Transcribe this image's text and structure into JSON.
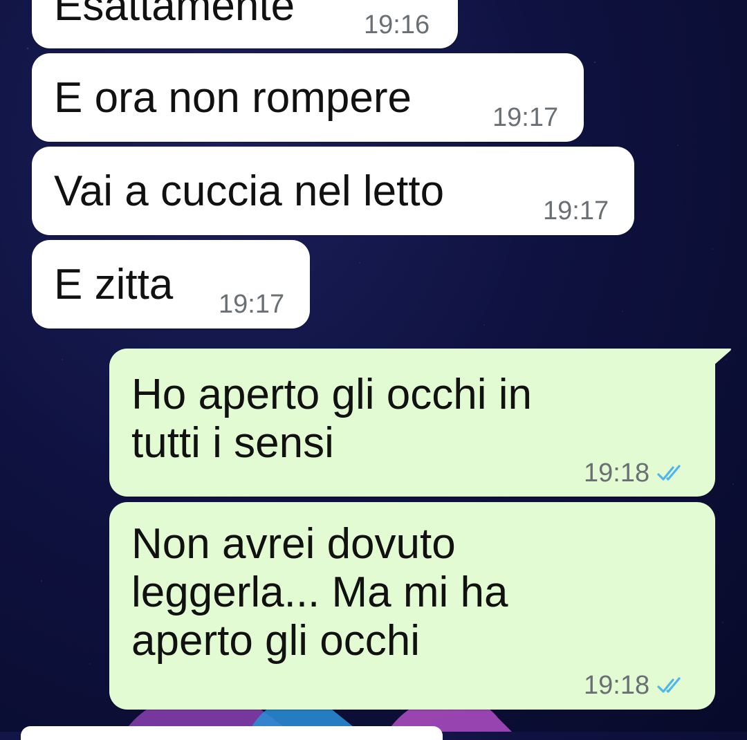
{
  "colors": {
    "incoming_bubble": "#ffffff",
    "outgoing_bubble": "#e3fbd2",
    "read_ticks": "#4fb6ec",
    "timestamp": "#6a6f74"
  },
  "messages": [
    {
      "direction": "incoming",
      "text": "Esattamente",
      "time": "19:16"
    },
    {
      "direction": "incoming",
      "text": "E ora non rompere",
      "time": "19:17"
    },
    {
      "direction": "incoming",
      "text": "Vai a cuccia nel letto",
      "time": "19:17"
    },
    {
      "direction": "incoming",
      "text": "E zitta",
      "time": "19:17"
    },
    {
      "direction": "outgoing",
      "text": "Ho aperto gli occhi in\ntutti i sensi",
      "time": "19:18",
      "status_icon": "double-check-read-icon"
    },
    {
      "direction": "outgoing",
      "text": "Non avrei dovuto\nleggerla... Ma mi ha\naperto gli occhi",
      "time": "19:18",
      "status_icon": "double-check-read-icon"
    }
  ]
}
